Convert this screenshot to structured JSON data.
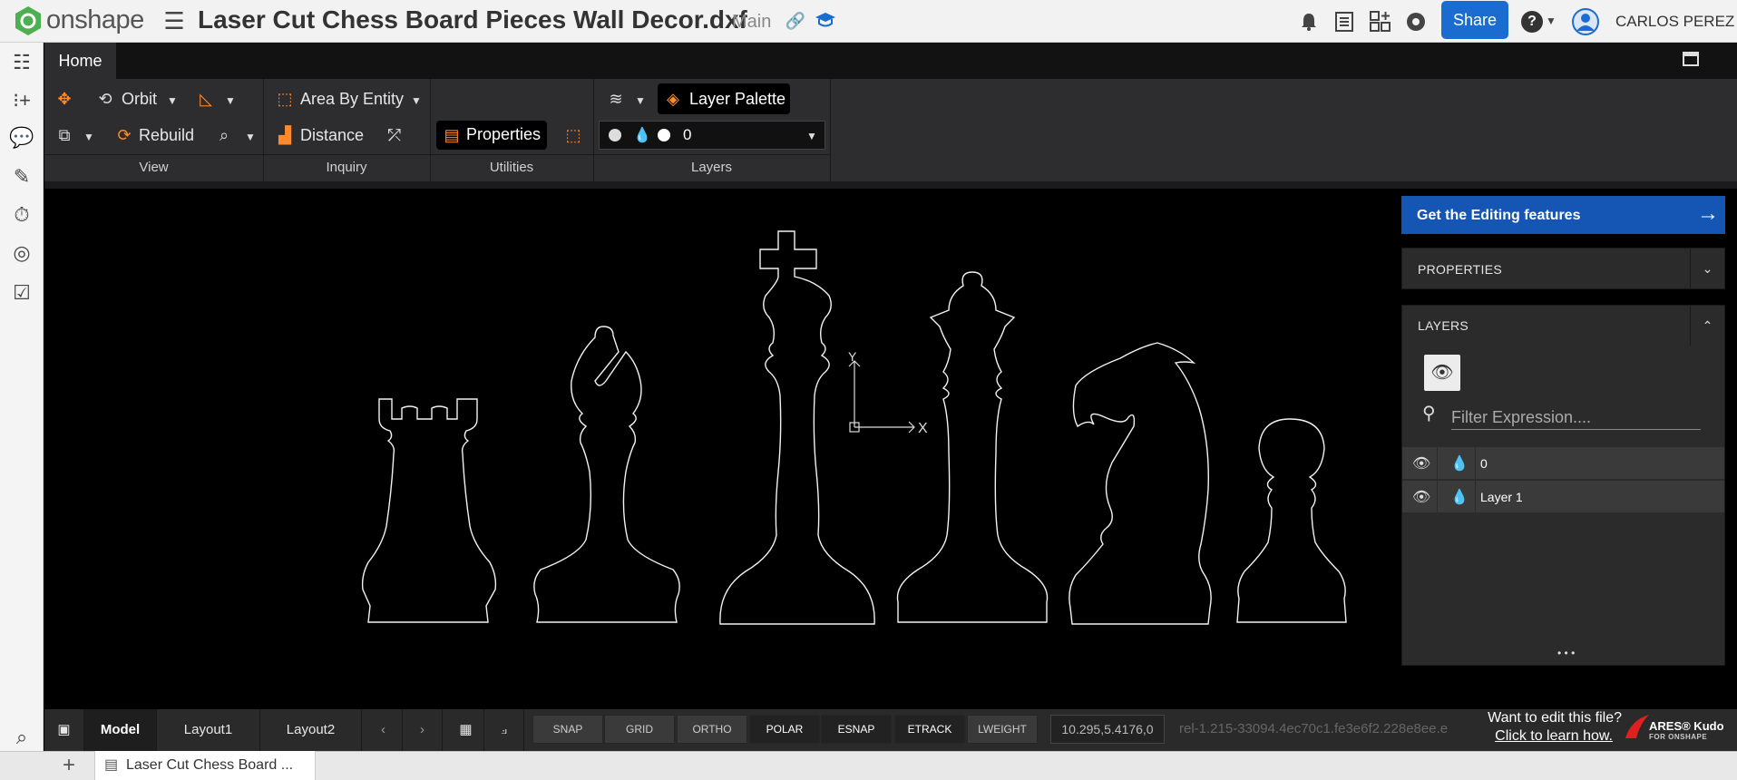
{
  "topbar": {
    "logo_text": "onshape",
    "doc_title": "Laser Cut Chess Board Pieces Wall Decor.dxf",
    "branch": "Main",
    "share_label": "Share",
    "user_name": "CARLOS PEREZ",
    "help_glyph": "?"
  },
  "ribbon": {
    "home_tab": "Home",
    "orbit_label": "Orbit",
    "rebuild_label": "Rebuild",
    "area_label": "Area By Entity",
    "distance_label": "Distance",
    "properties_label": "Properties",
    "layer_palette_label": "Layer Palette",
    "layer_value": "0",
    "groups": [
      "View",
      "Inquiry",
      "Utilities",
      "Layers"
    ]
  },
  "canvas": {
    "axis_x": "X",
    "axis_y": "Y"
  },
  "right_panel": {
    "get_features": "Get the Editing features",
    "properties_title": "PROPERTIES",
    "layers_title": "LAYERS",
    "filter_placeholder": "Filter Expression....",
    "layers": [
      {
        "name": "0"
      },
      {
        "name": "Layer 1"
      }
    ],
    "more_dots": "• • •"
  },
  "bottombar": {
    "tabs": [
      "Model",
      "Layout1",
      "Layout2"
    ],
    "modes": [
      "SNAP",
      "GRID",
      "ORTHO",
      "POLAR",
      "ESNAP",
      "ETRACK",
      "LWEIGHT"
    ],
    "coordinates": "10.295,5.4176,0",
    "release": "rel-1.215-33094.4ec70c1.fe3e6f2.228e8ee.e",
    "want_edit": "Want to edit this file?",
    "learn_how": "Click to learn how.",
    "brand_line1": "ARES® Kudo",
    "brand_line2": "FOR ONSHAPE"
  },
  "footer": {
    "doc_tab": "Laser Cut Chess Board ...",
    "add_glyph": "+"
  },
  "colors": {
    "accent_orange": "#ff8a2b",
    "brand_blue": "#1556b5",
    "onshape_green": "#4caf50"
  }
}
